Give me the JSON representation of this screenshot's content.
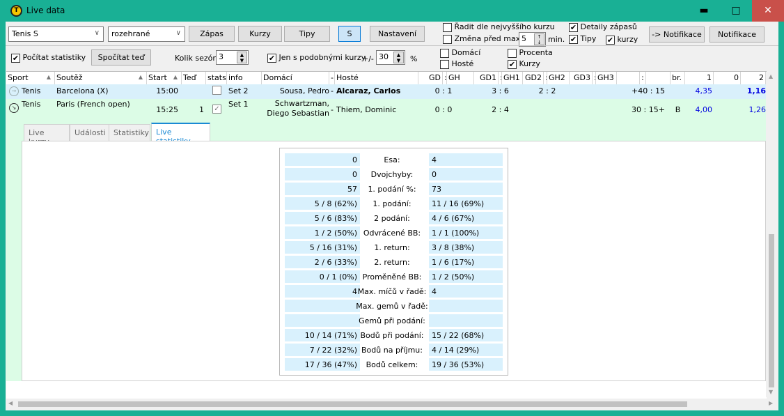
{
  "window": {
    "title": "Live data",
    "controls": [
      "minimize",
      "maximize",
      "close"
    ]
  },
  "toolbar": {
    "sport_combo": "Tenis S",
    "state_combo": "rozehrané",
    "buttons": [
      "Zápas",
      "Kurzy",
      "Tipy",
      "S",
      "Nastavení"
    ],
    "sort_by_odds": {
      "label": "Řadit dle nejvyššího kurzu",
      "checked": false
    },
    "change_before": {
      "label": "Změna před max.",
      "checked": false,
      "value": "5",
      "unit": "min."
    },
    "match_details": {
      "label": "Detaily zápasů",
      "checked": true
    },
    "tips": {
      "label": "Tipy",
      "checked": true
    },
    "odds": {
      "label": "kurzy",
      "checked": true
    },
    "notify_arrow": "-> Notifikace",
    "notify": "Notifikace"
  },
  "stats_bar": {
    "count_stats": {
      "label": "Počítat statistiky",
      "checked": true
    },
    "compute_now": "Spočítat teď",
    "seasons_label": "Kolik sezón",
    "seasons": "3",
    "similar_odds": {
      "label": "Jen s podobnými kurzy",
      "checked": true
    },
    "plusminus": "+/-",
    "percent_value": "30",
    "percent": "%",
    "home": {
      "label": "Domácí",
      "checked": false
    },
    "away": {
      "label": "Hosté",
      "checked": false
    },
    "percenta": {
      "label": "Procenta",
      "checked": false
    },
    "kurzy": {
      "label": "Kurzy",
      "checked": true
    }
  },
  "grid": {
    "columns": [
      "Sport",
      "Soutěž",
      "Start",
      "Teď",
      "stats",
      "info",
      "Domácí",
      "-",
      "Hosté",
      "GD",
      ":",
      "GH",
      "GD1",
      ":",
      "GH1",
      "GD2",
      ":",
      "GH2",
      "GD3",
      ":",
      "GH3",
      "",
      ":",
      "",
      "br.",
      "1",
      "0",
      "2"
    ],
    "rows": [
      {
        "sport": "Tenis",
        "competition": "Barcelona (X)",
        "start": "15:00",
        "now": "",
        "stats": false,
        "info": "Set 2",
        "home": "Sousa, Pedro",
        "sep": "-",
        "away": "Alcaraz, Carlos",
        "gd": "0 : 1",
        "set1": "3 : 6",
        "set2": "2 : 2",
        "set3": "",
        "points": "+40 : 15",
        "br": "",
        "o1": "4,35",
        "o0": "",
        "o2": "1,16"
      },
      {
        "sport": "Tenis",
        "competition": "Paris (French open)",
        "start": "15:25",
        "now": "1",
        "stats": true,
        "info": "Set 1",
        "home": "Schwartzman, Diego Sebastian",
        "home1": "Schwartzman,",
        "home2": "Diego Sebastian",
        "sep": "-",
        "away": "Thiem, Dominic",
        "gd": "0 : 0",
        "set1": "2 : 4",
        "set2": "",
        "set3": "",
        "points": "30 : 15+",
        "br": "B",
        "o1": "4,00",
        "o0": "",
        "o2": "1,26"
      }
    ]
  },
  "tabs": [
    "Live kurzy",
    "Události",
    "Statistiky",
    "Live statistiky"
  ],
  "active_tab": "Live statistiky",
  "live_stats": [
    {
      "h": "0",
      "label": "Esa:",
      "a": "4"
    },
    {
      "h": "0",
      "label": "Dvojchyby:",
      "a": "0"
    },
    {
      "h": "57",
      "label": "1. podání %:",
      "a": "73"
    },
    {
      "h": "5 / 8 (62%)",
      "label": "1. podání:",
      "a": "11 / 16 (69%)"
    },
    {
      "h": "5 / 6 (83%)",
      "label": "2 podání:",
      "a": "4 / 6 (67%)"
    },
    {
      "h": "1 / 2 (50%)",
      "label": "Odvrácené BB:",
      "a": "1 / 1 (100%)"
    },
    {
      "h": "5 / 16 (31%)",
      "label": "1. return:",
      "a": "3 / 8 (38%)"
    },
    {
      "h": "2 / 6 (33%)",
      "label": "2. return:",
      "a": "1 / 6 (17%)"
    },
    {
      "h": "0 / 1 (0%)",
      "label": "Proměněné BB:",
      "a": "1 / 2 (50%)"
    },
    {
      "h": "4",
      "label": "Max. míčů v řadě:",
      "a": "4"
    },
    {
      "h": "",
      "label": "Max. gemů v řadě:",
      "a": ""
    },
    {
      "h": "",
      "label": "Gemů při podání:",
      "a": ""
    },
    {
      "h": "10 / 14 (71%)",
      "label": "Bodů při podání:",
      "a": "15 / 22 (68%)"
    },
    {
      "h": "7 / 22 (32%)",
      "label": "Bodů na příjmu:",
      "a": "4 / 14 (29%)"
    },
    {
      "h": "17 / 36 (47%)",
      "label": "Bodů celkem:",
      "a": "19 / 36 (53%)"
    }
  ],
  "colors": {
    "titlebar": "#19b095",
    "row_selected": "#d9f0fb",
    "row_expanded": "#dcfce6",
    "odds": "#0000e0",
    "active_tab": "#1a8ad4",
    "stat_cell": "#d9f1fd"
  }
}
